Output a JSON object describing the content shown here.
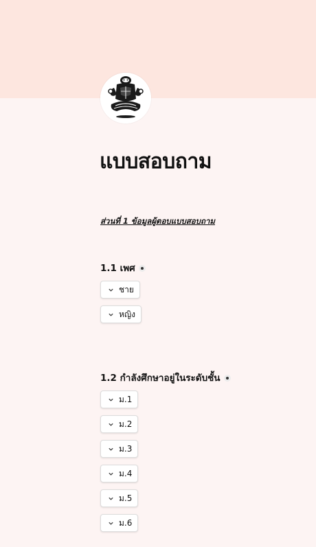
{
  "form": {
    "title": "แบบสอบถาม",
    "section_heading": "ส่วนที่ 1 ข้อมูลผู้ตอบแบบสอบถาม"
  },
  "questions": [
    {
      "label": "1.1 เพศ",
      "required": true,
      "options": [
        "ชาย",
        "หญิง"
      ]
    },
    {
      "label": "1.2  กำลังศึกษาอยู่ในระดับชั้น",
      "required": true,
      "options": [
        "ม.1",
        "ม.2",
        "ม.3",
        "ม.4",
        "ม.5",
        "ม.6"
      ]
    }
  ],
  "icons": {
    "option": "chevron-down-icon",
    "required": "required-dot-icon",
    "logo": "meditating-figure-logo"
  },
  "colors": {
    "header_band": "#fde6df",
    "page_background": "#fdf4f3"
  }
}
